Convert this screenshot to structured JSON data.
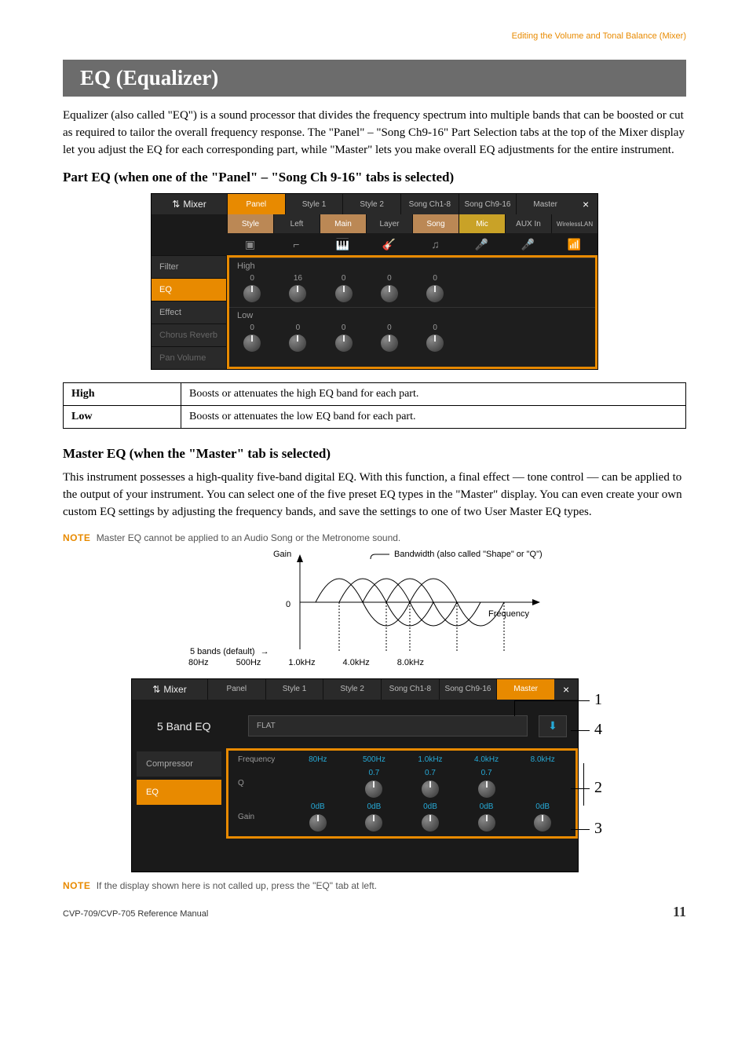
{
  "breadcrumb": "Editing the Volume and Tonal Balance (Mixer)",
  "section_title": "EQ (Equalizer)",
  "intro": "Equalizer (also called \"EQ\") is a sound processor that divides the frequency spectrum into multiple bands that can be boosted or cut as required to tailor the overall frequency response. The \"Panel\" – \"Song Ch9-16\" Part Selection tabs at the top of the Mixer display let you adjust the EQ for each corresponding part, while \"Master\" lets you make overall EQ adjustments for the entire instrument.",
  "parteq_heading": "Part EQ (when one of the \"Panel\" – \"Song Ch 9-16\" tabs is selected)",
  "mixer": {
    "title": "Mixer",
    "tabs": [
      "Panel",
      "Style 1",
      "Style 2",
      "Song Ch1-8",
      "Song Ch9-16",
      "Master"
    ],
    "close": "×",
    "parts": [
      "Style",
      "Left",
      "Main",
      "Layer",
      "Song",
      "Mic",
      "AUX In",
      "WirelessLAN"
    ],
    "left_tabs": [
      "Filter",
      "EQ",
      "Effect",
      "Chorus Reverb",
      "Pan Volume"
    ],
    "high_label": "High",
    "low_label": "Low",
    "high_vals": [
      "0",
      "16",
      "0",
      "0",
      "0",
      "",
      "",
      ""
    ],
    "low_vals": [
      "0",
      "0",
      "0",
      "0",
      "0",
      "",
      "",
      ""
    ]
  },
  "param_table": [
    {
      "name": "High",
      "desc": "Boosts or attenuates the high EQ band for each part."
    },
    {
      "name": "Low",
      "desc": "Boosts or attenuates the low EQ band for each part."
    }
  ],
  "mastereq_heading": "Master EQ (when the \"Master\" tab is selected)",
  "mastereq_body": "This instrument possesses a high-quality five-band digital EQ. With this function, a final effect — tone control — can be applied to the output of your instrument. You can select one of the five preset EQ types in the \"Master\" display. You can even create your own custom EQ settings by adjusting the frequency bands, and save the settings to one of two User Master EQ types.",
  "note1_label": "NOTE",
  "note1_text": "Master EQ cannot be applied to an Audio Song or the Metronome sound.",
  "curve": {
    "gain": "Gain",
    "zero": "0",
    "bw": "Bandwidth (also called \"Shape\" or \"Q\")",
    "freq": "Frequency",
    "defaults": "5 bands (default)",
    "arrow": "→",
    "bands": [
      "80Hz",
      "500Hz",
      "1.0kHz",
      "4.0kHz",
      "8.0kHz"
    ]
  },
  "master": {
    "title": "Mixer",
    "tabs": [
      "Panel",
      "Style 1",
      "Style 2",
      "Song Ch1-8",
      "Song Ch9-16",
      "Master"
    ],
    "close": "×",
    "header_title": "5 Band EQ",
    "flat": "FLAT",
    "left_tabs": [
      "Compressor",
      "EQ"
    ],
    "rows": {
      "freq_label": "Frequency",
      "freq": [
        "80Hz",
        "500Hz",
        "1.0kHz",
        "4.0kHz",
        "8.0kHz"
      ],
      "q_label": "Q",
      "q": [
        "",
        "0.7",
        "0.7",
        "0.7",
        ""
      ],
      "gain_label": "Gain",
      "gain": [
        "0dB",
        "0dB",
        "0dB",
        "0dB",
        "0dB"
      ]
    }
  },
  "callouts": {
    "c1": "1",
    "c2": "2",
    "c3": "3",
    "c4": "4"
  },
  "note2_label": "NOTE",
  "note2_text": "If the display shown here is not called up, press the \"EQ\" tab at left.",
  "footer_left": "CVP-709/CVP-705 Reference Manual",
  "page_num": "11"
}
